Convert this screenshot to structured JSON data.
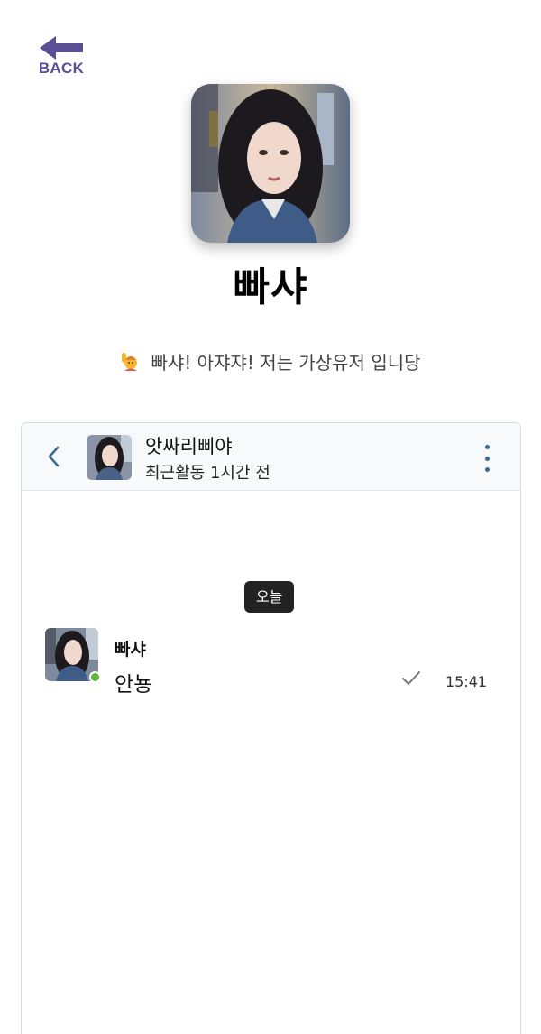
{
  "nav": {
    "back_label": "BACK"
  },
  "profile": {
    "name": "빠샤",
    "bio_icon": "raising-hand-emoji",
    "bio": "빠샤! 아쟈쟈! 저는 가상유저 입니당"
  },
  "chat": {
    "header": {
      "title": "앗싸리삐야",
      "status": "최근활동 1시간 전"
    },
    "date_divider": "오늘",
    "messages": [
      {
        "sender": "빠샤",
        "text": "안뇽",
        "time": "15:41",
        "status_icon": "check-icon",
        "online": true
      }
    ]
  },
  "colors": {
    "back_accent": "#5a4f94",
    "icon_accent": "#3a6c8e",
    "online": "#5cb63a",
    "pill_bg": "#222222"
  }
}
